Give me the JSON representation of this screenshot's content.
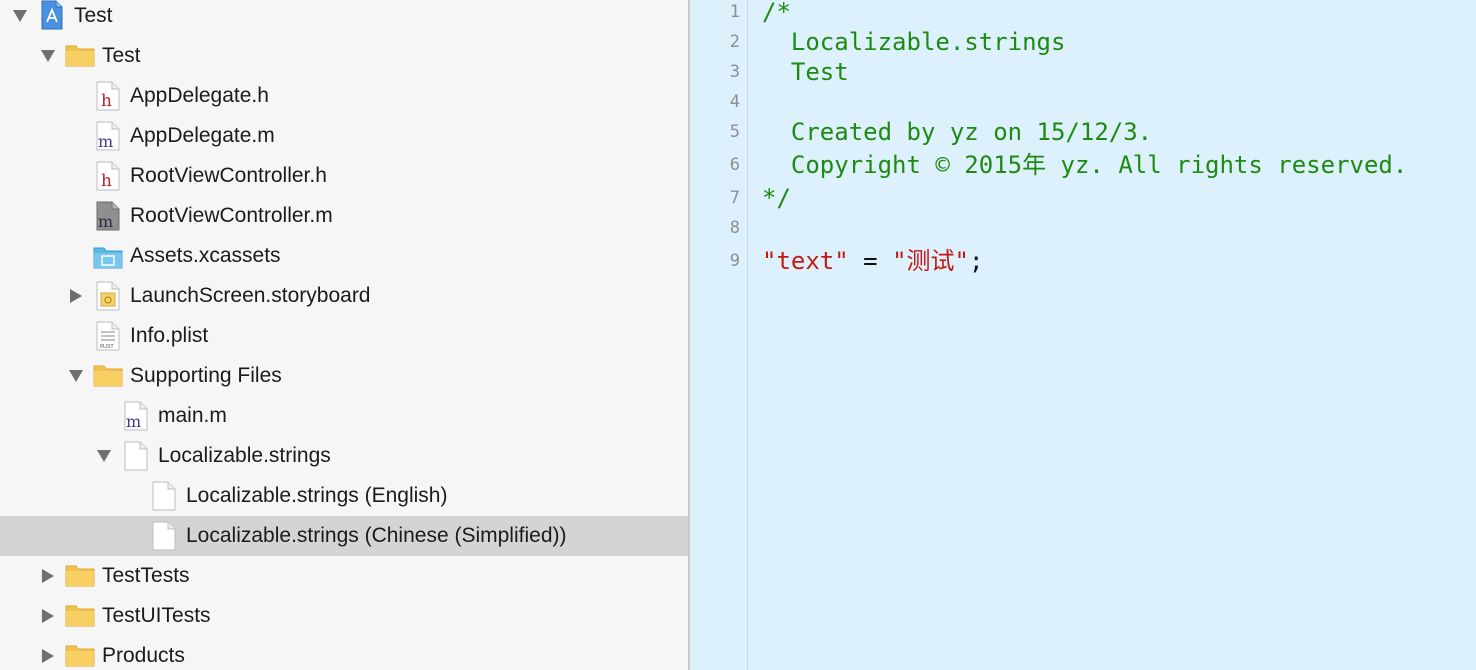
{
  "navigator": {
    "items": [
      {
        "label": "Test",
        "icon": "project-icon",
        "disclosure": "expanded"
      },
      {
        "label": "Test",
        "icon": "folder-icon",
        "disclosure": "expanded"
      },
      {
        "label": "AppDelegate.h",
        "icon": "header-file-icon",
        "glyph": "h"
      },
      {
        "label": "AppDelegate.m",
        "icon": "objc-file-icon",
        "glyph": "m"
      },
      {
        "label": "RootViewController.h",
        "icon": "header-file-icon",
        "glyph": "h"
      },
      {
        "label": "RootViewController.m",
        "icon": "objc-file-icon-gray",
        "glyph": "m"
      },
      {
        "label": "Assets.xcassets",
        "icon": "asset-catalog-icon"
      },
      {
        "label": "LaunchScreen.storyboard",
        "icon": "storyboard-icon",
        "disclosure": "collapsed"
      },
      {
        "label": "Info.plist",
        "icon": "plist-icon",
        "glyph": "PLIST"
      },
      {
        "label": "Supporting Files",
        "icon": "folder-icon",
        "disclosure": "expanded"
      },
      {
        "label": "main.m",
        "icon": "objc-file-icon",
        "glyph": "m"
      },
      {
        "label": "Localizable.strings",
        "icon": "strings-file-icon",
        "disclosure": "expanded"
      },
      {
        "label": "Localizable.strings (English)",
        "icon": "strings-file-icon"
      },
      {
        "label": "Localizable.strings (Chinese (Simplified))",
        "icon": "strings-file-icon",
        "selected": true
      },
      {
        "label": "TestTests",
        "icon": "folder-icon",
        "disclosure": "collapsed"
      },
      {
        "label": "TestUITests",
        "icon": "folder-icon",
        "disclosure": "collapsed"
      },
      {
        "label": "Products",
        "icon": "folder-icon",
        "disclosure": "collapsed"
      }
    ]
  },
  "editor": {
    "line_numbers": [
      "1",
      "2",
      "3",
      "4",
      "5",
      "6",
      "7",
      "8",
      "9"
    ],
    "lines": {
      "l1": "/*",
      "l2": "  Localizable.strings",
      "l3": "  Test",
      "l4": "",
      "l5": "  Created by yz on 15/12/3.",
      "l6": "  Copyright © 2015年 yz. All rights reserved.",
      "l7": "*/",
      "l8": "",
      "l9_key": "\"text\"",
      "l9_eq": " = ",
      "l9_value": "\"测试\"",
      "l9_end": ";"
    }
  },
  "colors": {
    "editor_background": "#dcf1fb",
    "comment": "#1f8a12",
    "string": "#c41a16",
    "selection": "#d4d4d4",
    "folder": "#f2c14e"
  }
}
